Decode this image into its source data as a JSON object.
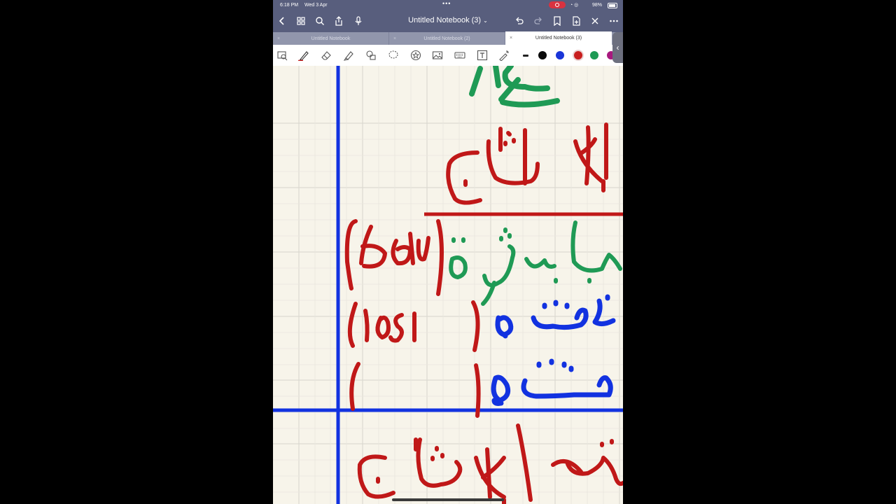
{
  "status_bar": {
    "time": "6:18 PM",
    "date": "Wed 3 Apr",
    "battery": "98%"
  },
  "nav": {
    "title": "Untitled Notebook (3)"
  },
  "tabs": [
    {
      "label": "Untitled Notebook",
      "active": false
    },
    {
      "label": "Untitled Notebook (2)",
      "active": false
    },
    {
      "label": "Untitled Notebook (3)",
      "active": true
    }
  ],
  "toolbar": {
    "tools": [
      "lasso-view-icon",
      "pen-icon",
      "eraser-icon",
      "highlighter-icon",
      "shapes-icon",
      "lasso-icon",
      "sticker-icon",
      "image-icon",
      "keyboard-icon",
      "text-icon",
      "laser-pointer-icon"
    ],
    "colors": [
      "#222222",
      "#0a0a0a",
      "#1a35d8",
      "#c81e1e",
      "#1e9a55",
      "#a8197e"
    ],
    "selected_color": "#c81e1e"
  },
  "ink_colors": {
    "red": "#c01818",
    "green": "#1f9a55",
    "blue": "#1232e0"
  }
}
